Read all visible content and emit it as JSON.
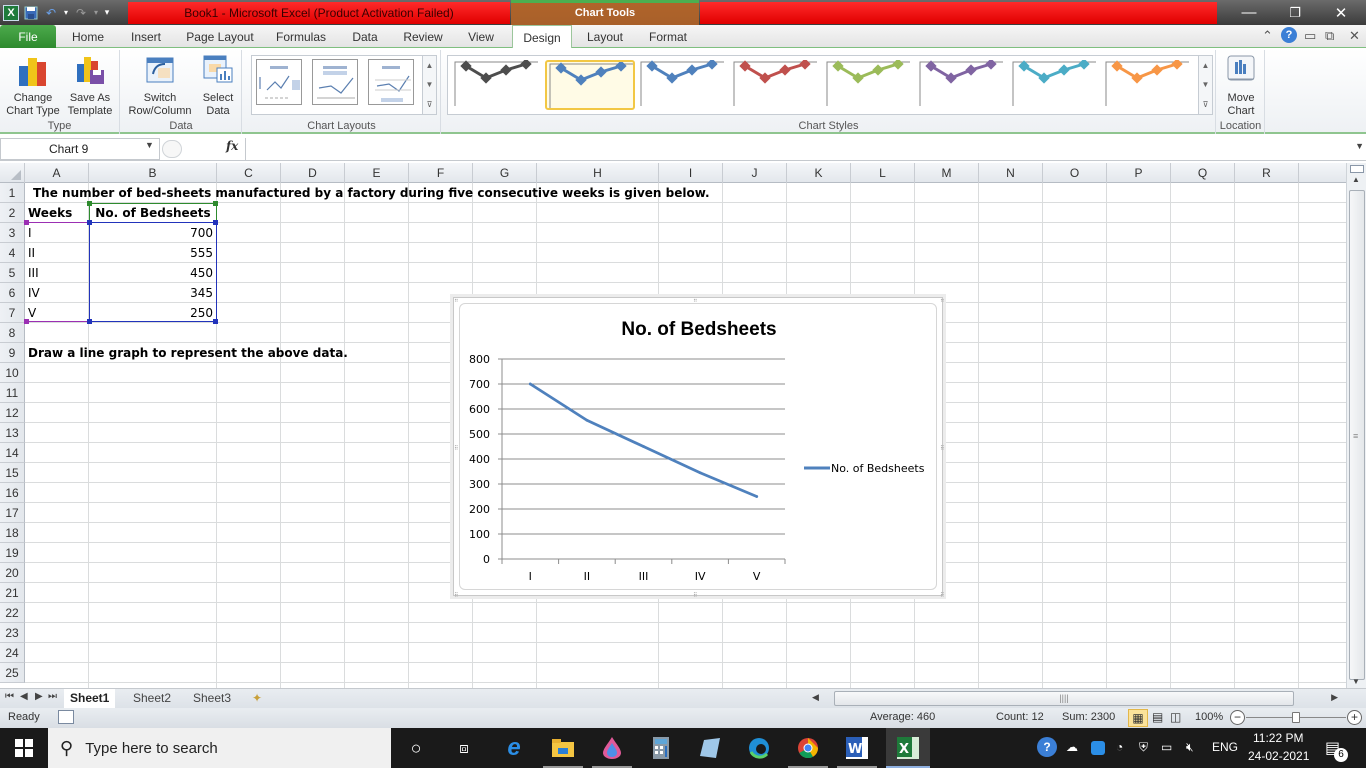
{
  "window": {
    "title": "Book1  -  Microsoft Excel (Product Activation Failed)",
    "contextual_tab_group": "Chart Tools",
    "controls": {
      "minimize": "—",
      "restore": "❐",
      "close": "✕"
    }
  },
  "quick_access": {
    "icons": [
      "excel-logo-icon",
      "save-icon",
      "undo-icon",
      "redo-icon",
      "customize-qat-icon"
    ]
  },
  "ribbon_tabs": [
    {
      "id": "file",
      "label": "File"
    },
    {
      "id": "home",
      "label": "Home"
    },
    {
      "id": "insert",
      "label": "Insert"
    },
    {
      "id": "page-layout",
      "label": "Page Layout"
    },
    {
      "id": "formulas",
      "label": "Formulas"
    },
    {
      "id": "data",
      "label": "Data"
    },
    {
      "id": "review",
      "label": "Review"
    },
    {
      "id": "view",
      "label": "View"
    },
    {
      "id": "design",
      "label": "Design",
      "active": true
    },
    {
      "id": "layout",
      "label": "Layout"
    },
    {
      "id": "format",
      "label": "Format"
    }
  ],
  "ribbon": {
    "groups": {
      "type": {
        "label": "Type",
        "change_chart_type": "Change Chart Type",
        "change_chart_type_l1": "Change",
        "change_chart_type_l2": "Chart Type",
        "save_as_template_l1": "Save As",
        "save_as_template_l2": "Template"
      },
      "data": {
        "label": "Data",
        "switch_l1": "Switch",
        "switch_l2": "Row/Column",
        "select_l1": "Select",
        "select_l2": "Data"
      },
      "chart_layouts": {
        "label": "Chart Layouts",
        "count_visible": 3
      },
      "chart_styles": {
        "label": "Chart Styles",
        "styles": [
          {
            "color": "#4d4d4d"
          },
          {
            "color": "#4f81bd",
            "selected": true
          },
          {
            "color": "#4f81bd"
          },
          {
            "color": "#c0504d"
          },
          {
            "color": "#9bbb59"
          },
          {
            "color": "#8064a2"
          },
          {
            "color": "#4bacc6"
          },
          {
            "color": "#f79646"
          }
        ]
      },
      "location": {
        "label": "Location",
        "move_l1": "Move",
        "move_l2": "Chart"
      }
    }
  },
  "formula_bar": {
    "name_box": "Chart 9",
    "fx_label": "fx",
    "formula": ""
  },
  "sheet": {
    "columns": [
      "A",
      "B",
      "C",
      "D",
      "E",
      "F",
      "G",
      "H",
      "I",
      "J",
      "K",
      "L",
      "M",
      "N",
      "O",
      "P",
      "Q",
      "R"
    ],
    "rows": [
      "1",
      "2",
      "3",
      "4",
      "5",
      "6",
      "7",
      "8",
      "9",
      "10",
      "11",
      "12",
      "13",
      "14",
      "15",
      "16",
      "17",
      "18",
      "19",
      "20",
      "21",
      "22",
      "23",
      "24",
      "25"
    ],
    "cells": {
      "A1": "The number of bed-sheets manufactured by a factory during five consecutive weeks is given below.",
      "A2": "Weeks",
      "B2": "No. of Bedsheets",
      "A3": "I",
      "B3": "700",
      "A4": "II",
      "B4": "555",
      "A5": "III",
      "B5": "450",
      "A6": "IV",
      "B6": "345",
      "A7": "V",
      "B7": "250",
      "A9": "Draw a line graph to represent the above data."
    }
  },
  "chart_data": {
    "type": "line",
    "title": "No. of Bedsheets",
    "categories": [
      "I",
      "II",
      "III",
      "IV",
      "V"
    ],
    "series": [
      {
        "name": "No. of Bedsheets",
        "values": [
          700,
          555,
          450,
          345,
          250
        ],
        "color": "#4f81bd"
      }
    ],
    "xlabel": "",
    "ylabel": "",
    "ylim": [
      0,
      800
    ],
    "yticks": [
      0,
      100,
      200,
      300,
      400,
      500,
      600,
      700,
      800
    ],
    "grid": true,
    "legend": "right"
  },
  "sheet_tabs": [
    {
      "label": "Sheet1",
      "active": true
    },
    {
      "label": "Sheet2"
    },
    {
      "label": "Sheet3"
    }
  ],
  "status_bar": {
    "mode": "Ready",
    "average": "Average: 460",
    "count": "Count: 12",
    "sum": "Sum: 2300",
    "zoom": "100%",
    "zoom_fraction": 0.5
  },
  "taskbar": {
    "search_placeholder": "Type here to search",
    "time": "11:22 PM",
    "date": "24-02-2021",
    "language": "ENG",
    "notifications": "6",
    "apps": [
      "cortana-icon",
      "task-view-icon",
      "internet-explorer-icon",
      "file-explorer-icon",
      "paint3d-icon",
      "calculator-icon",
      "notepad-icon",
      "edge-icon",
      "chrome-icon",
      "word-icon",
      "excel-icon"
    ]
  }
}
